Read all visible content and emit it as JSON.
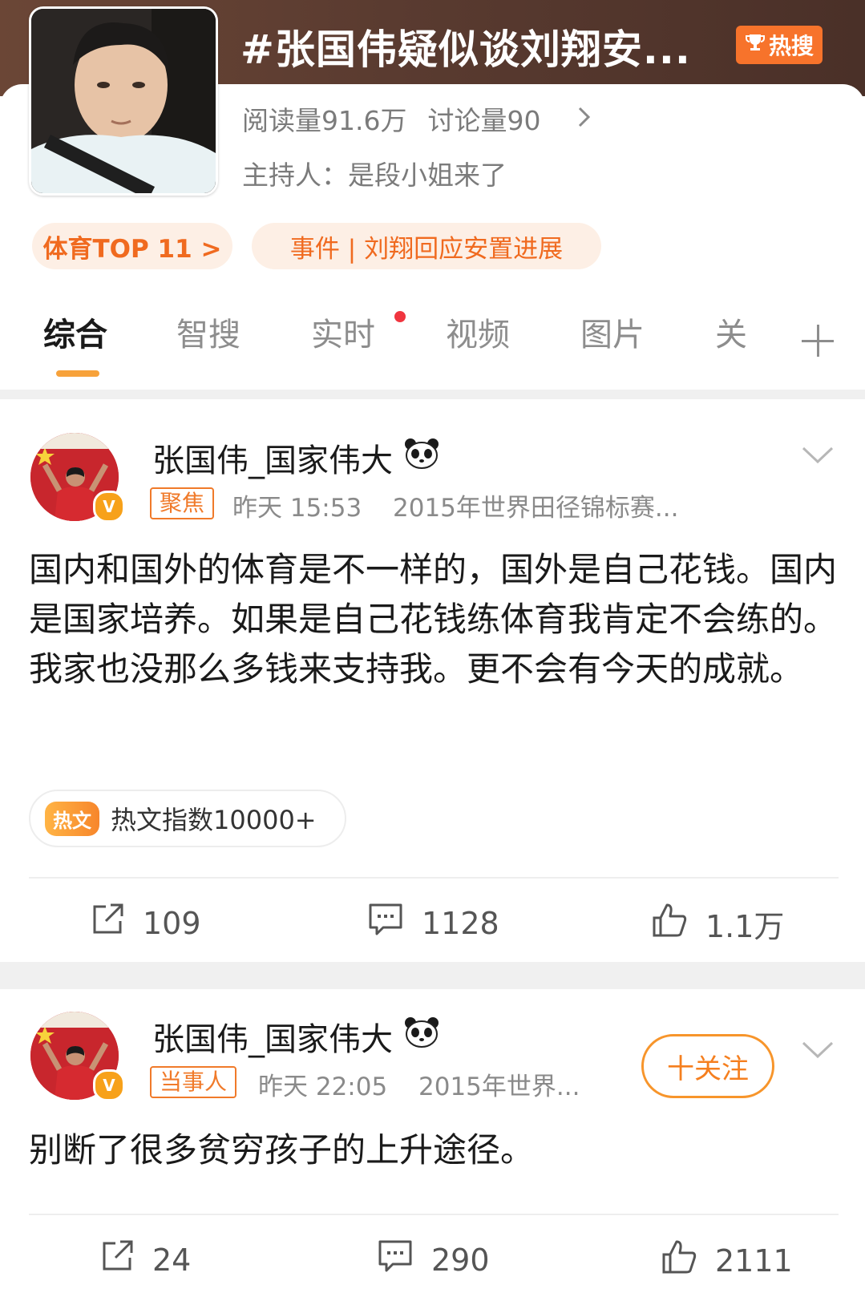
{
  "topic": {
    "title": "#张国伟疑似谈刘翔安...",
    "hot_badge": "热搜",
    "reads": "阅读量91.6万",
    "discussions": "讨论量90",
    "host": "主持人：是段小姐来了",
    "pills": [
      "体育TOP 11 >",
      "事件 | 刘翔回应安置进展"
    ]
  },
  "tabs": [
    {
      "label": "综合"
    },
    {
      "label": "智搜"
    },
    {
      "label": "实时"
    },
    {
      "label": "视频"
    },
    {
      "label": "图片"
    },
    {
      "label": "关"
    }
  ],
  "posts": [
    {
      "username": "张国伟_国家伟大",
      "tag": "聚焦",
      "time": "昨天 15:53",
      "source": "2015年世界田径锦标赛...",
      "text": "国内和国外的体育是不一样的，国外是自己花钱。国内是国家培养。如果是自己花钱练体育我肯定不会练的。我家也没那么多钱来支持我。更不会有今天的成就。",
      "hot_label": "热文",
      "hot_index": "热文指数10000+",
      "reposts": "109",
      "comments": "1128",
      "likes": "1.1万"
    },
    {
      "username": "张国伟_国家伟大",
      "tag": "当事人",
      "time": "昨天 22:05",
      "source": "2015年世界...",
      "follow_label": "十关注",
      "text": "别断了很多贫穷孩子的上升途径。",
      "reposts": "24",
      "comments": "290",
      "likes": "2111"
    }
  ],
  "colors": {
    "accent": "#f7732b",
    "header_bg": "#5a3b30",
    "tab_active_underline": "#f7a23b",
    "live_dot": "#f0353f"
  }
}
